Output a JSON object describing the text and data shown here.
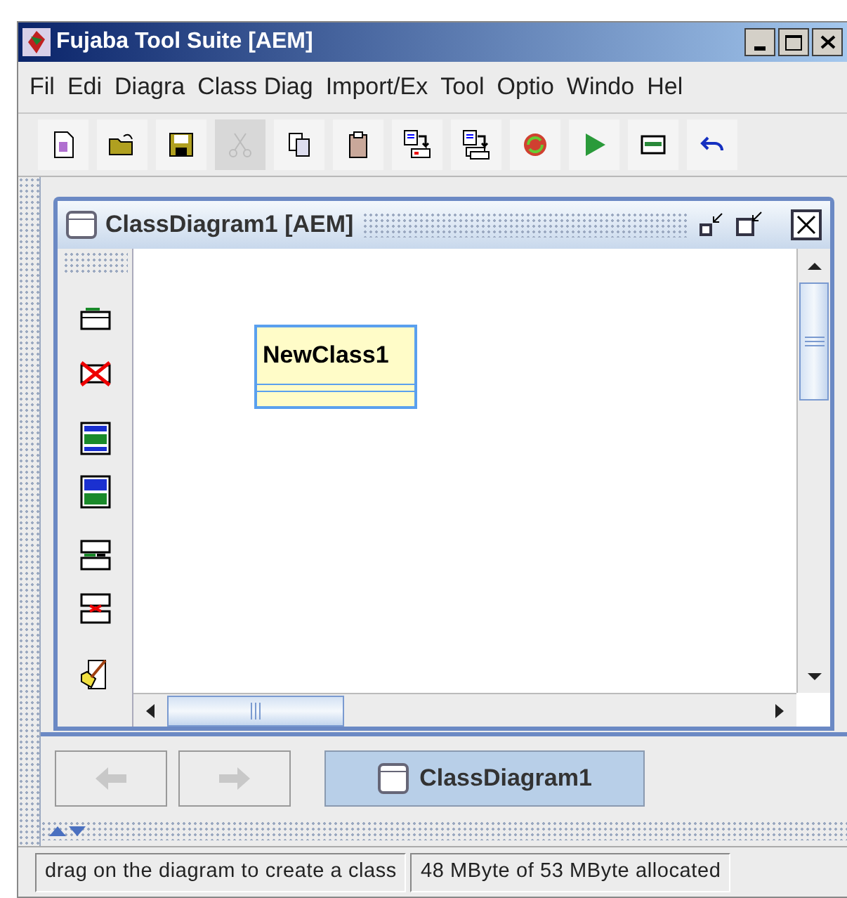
{
  "window": {
    "title": "Fujaba Tool Suite [AEM]"
  },
  "menu": [
    "Fil",
    "Edi",
    "Diagra",
    "Class Diag",
    "Import/Ex",
    "Tool",
    "Optio",
    "Windo",
    "Hel"
  ],
  "toolbar": [
    {
      "kind": "new",
      "disabled": false
    },
    {
      "kind": "open",
      "disabled": false
    },
    {
      "kind": "save",
      "disabled": false
    },
    {
      "kind": "cut",
      "disabled": true
    },
    {
      "kind": "copy",
      "disabled": false
    },
    {
      "kind": "paste",
      "disabled": false
    },
    {
      "kind": "export",
      "disabled": false
    },
    {
      "kind": "export-all",
      "disabled": false
    },
    {
      "kind": "refresh",
      "disabled": false
    },
    {
      "kind": "run",
      "disabled": false
    },
    {
      "kind": "panel",
      "disabled": false
    },
    {
      "kind": "undo",
      "disabled": false
    }
  ],
  "diagram_frame": {
    "title": "ClassDiagram1 [AEM]",
    "palette": [
      {
        "kind": "new-class"
      },
      {
        "kind": "delete-class"
      },
      {
        "kind": "attributes"
      },
      {
        "kind": "methods"
      },
      {
        "kind": "add-row"
      },
      {
        "kind": "delete-row"
      },
      {
        "kind": "edit"
      }
    ],
    "classes": [
      {
        "name": "NewClass1"
      }
    ]
  },
  "navigation": {
    "back_disabled": true,
    "forward_disabled": true,
    "tabs": [
      {
        "label": "ClassDiagram1",
        "selected": true
      }
    ]
  },
  "status_bar": [
    "drag on the diagram to create a class",
    "48 MByte of 53 MByte allocated"
  ]
}
